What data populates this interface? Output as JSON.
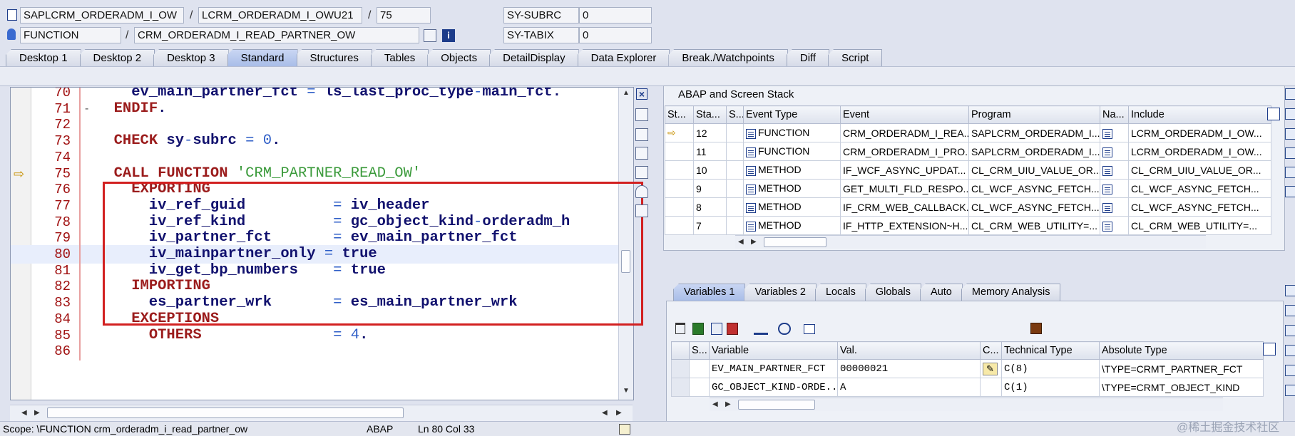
{
  "header": {
    "row1": {
      "program": "SAPLCRM_ORDERADM_I_OW",
      "sep1": "/",
      "include": "LCRM_ORDERADM_I_OWU21",
      "sep2": "/",
      "line": "75",
      "sysfield": "SY-SUBRC",
      "sysvalue": "0"
    },
    "row2": {
      "type": "FUNCTION",
      "sep1": "/",
      "name": "CRM_ORDERADM_I_READ_PARTNER_OW",
      "sysfield": "SY-TABIX",
      "sysvalue": "0"
    }
  },
  "tabs": [
    "Desktop 1",
    "Desktop 2",
    "Desktop 3",
    "Standard",
    "Structures",
    "Tables",
    "Objects",
    "DetailDisplay",
    "Data Explorer",
    "Break./Watchpoints",
    "Diff",
    "Script"
  ],
  "active_tab": "Standard",
  "editor": {
    "current_line": "75",
    "cursor_line": "80",
    "lines": [
      {
        "n": "70",
        "code": "    ev_main_partner_fct = ls_last_proc_type-main_fct."
      },
      {
        "n": "71",
        "code": "  ENDIF."
      },
      {
        "n": "72",
        "code": ""
      },
      {
        "n": "73",
        "code": "  CHECK sy-subrc = 0."
      },
      {
        "n": "74",
        "code": ""
      },
      {
        "n": "75",
        "code": "  CALL FUNCTION 'CRM_PARTNER_READ_OW'"
      },
      {
        "n": "76",
        "code": "    EXPORTING"
      },
      {
        "n": "77",
        "code": "      iv_ref_guid          = iv_header"
      },
      {
        "n": "78",
        "code": "      iv_ref_kind          = gc_object_kind-orderadm_h"
      },
      {
        "n": "79",
        "code": "      iv_partner_fct       = ev_main_partner_fct"
      },
      {
        "n": "80",
        "code": "      iv_mainpartner_only = true"
      },
      {
        "n": "81",
        "code": "      iv_get_bp_numbers    = true"
      },
      {
        "n": "82",
        "code": "    IMPORTING"
      },
      {
        "n": "83",
        "code": "      es_partner_wrk       = es_main_partner_wrk"
      },
      {
        "n": "84",
        "code": "    EXCEPTIONS"
      },
      {
        "n": "85",
        "code": "      OTHERS               = 4."
      },
      {
        "n": "86",
        "code": ""
      }
    ]
  },
  "stack": {
    "title": "ABAP and Screen Stack",
    "columns": [
      "St...",
      "Sta...",
      "S...",
      "Event Type",
      "Event",
      "Program",
      "Na...",
      "Include"
    ],
    "rows": [
      {
        "level": "12",
        "type": "FUNCTION",
        "event": "CRM_ORDERADM_I_REA...",
        "program": "SAPLCRM_ORDERADM_I...",
        "include": "LCRM_ORDERADM_I_OW...",
        "current": true
      },
      {
        "level": "11",
        "type": "FUNCTION",
        "event": "CRM_ORDERADM_I_PRO...",
        "program": "SAPLCRM_ORDERADM_I...",
        "include": "LCRM_ORDERADM_I_OW..."
      },
      {
        "level": "10",
        "type": "METHOD",
        "event": "IF_WCF_ASYNC_UPDAT...",
        "program": "CL_CRM_UIU_VALUE_OR...",
        "include": "CL_CRM_UIU_VALUE_OR..."
      },
      {
        "level": "9",
        "type": "METHOD",
        "event": "GET_MULTI_FLD_RESPO...",
        "program": "CL_WCF_ASYNC_FETCH...",
        "include": "CL_WCF_ASYNC_FETCH..."
      },
      {
        "level": "8",
        "type": "METHOD",
        "event": "IF_CRM_WEB_CALLBACK...",
        "program": "CL_WCF_ASYNC_FETCH...",
        "include": "CL_WCF_ASYNC_FETCH..."
      },
      {
        "level": "7",
        "type": "METHOD",
        "event": "IF_HTTP_EXTENSION~H...",
        "program": "CL_CRM_WEB_UTILITY=...",
        "include": "CL_CRM_WEB_UTILITY=..."
      }
    ]
  },
  "vars": {
    "tabs": [
      "Variables 1",
      "Variables 2",
      "Locals",
      "Globals",
      "Auto",
      "Memory Analysis"
    ],
    "active_tab": "Variables 1",
    "columns": [
      "S...",
      "Variable",
      "Val.",
      "C...",
      "Technical Type",
      "Absolute Type"
    ],
    "rows": [
      {
        "variable": "EV_MAIN_PARTNER_FCT",
        "value": "00000021",
        "tech": "C(8)",
        "abs": "\\TYPE=CRMT_PARTNER_FCT",
        "editable": true
      },
      {
        "variable": "GC_OBJECT_KIND-ORDE...",
        "value": "A",
        "tech": "C(1)",
        "abs": "\\TYPE=CRMT_OBJECT_KIND"
      }
    ]
  },
  "status": {
    "scope": "Scope: \\FUNCTION crm_orderadm_i_read_partner_ow",
    "lang": "ABAP",
    "pos": "Ln  80 Col  33"
  },
  "watermark": "@稀土掘金技术社区",
  "colors": {
    "highlight_box": "#d22020",
    "keyword": "#9b1c1c",
    "string": "#3a9a3a",
    "number": "#2d5dc7"
  }
}
